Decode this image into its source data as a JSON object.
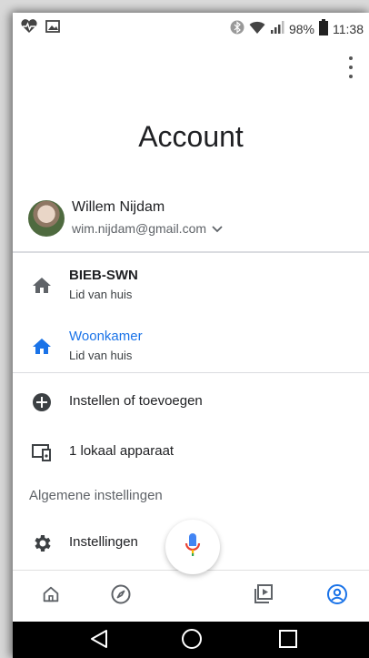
{
  "status_bar": {
    "battery": "98%",
    "time": "11:38"
  },
  "header": {
    "title": "Account"
  },
  "account": {
    "name": "Willem Nijdam",
    "email": "wim.nijdam@gmail.com"
  },
  "homes": [
    {
      "name": "BIEB-SWN",
      "role": "Lid van huis"
    },
    {
      "name": "Woonkamer",
      "role": "Lid van huis"
    }
  ],
  "actions": {
    "add": "Instellen of toevoegen",
    "local_devices": "1 lokaal apparaat"
  },
  "section": {
    "general": "Algemene instellingen"
  },
  "settings_item": "Instellingen",
  "colors": {
    "accent": "#1a73e8",
    "text": "#202124",
    "secondary": "#5f6368"
  }
}
